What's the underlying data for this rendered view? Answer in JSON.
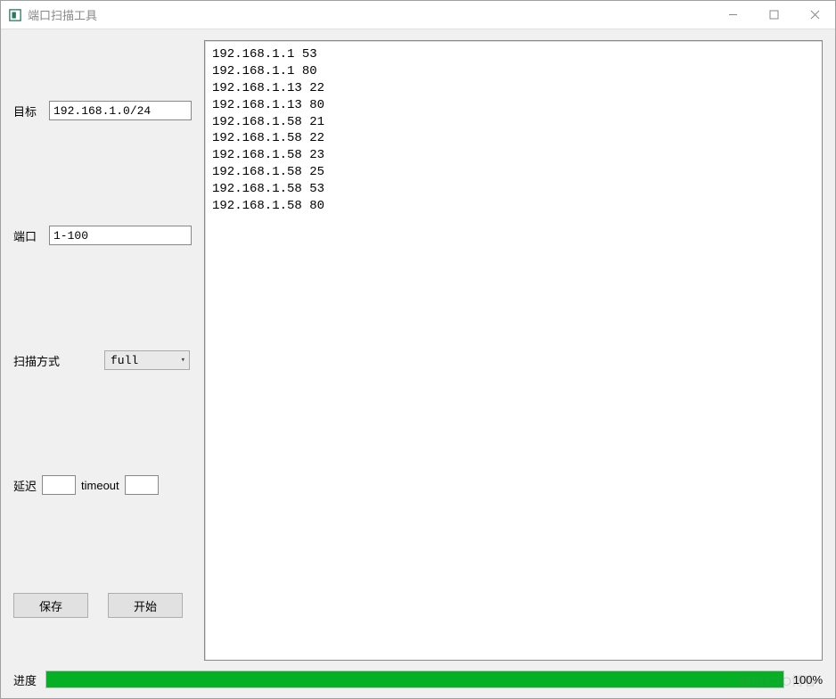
{
  "window": {
    "title": "端口扫描工具"
  },
  "fields": {
    "target_label": "目标",
    "target_value": "192.168.1.0/24",
    "port_label": "端口",
    "port_value": "1-100",
    "scan_mode_label": "扫描方式",
    "scan_mode_value": "full",
    "delay_label": "延迟",
    "delay_value": "",
    "timeout_label": "timeout",
    "timeout_value": ""
  },
  "buttons": {
    "save": "保存",
    "start": "开始"
  },
  "results": [
    "192.168.1.1 53",
    "192.168.1.1 80",
    "192.168.1.13 22",
    "192.168.1.13 80",
    "192.168.1.58 21",
    "192.168.1.58 22",
    "192.168.1.58 23",
    "192.168.1.58 25",
    "192.168.1.58 53",
    "192.168.1.58 80"
  ],
  "progress": {
    "label": "进度",
    "percent_text": "100%",
    "percent_value": 100
  },
  "watermark": "@51CTO博客"
}
